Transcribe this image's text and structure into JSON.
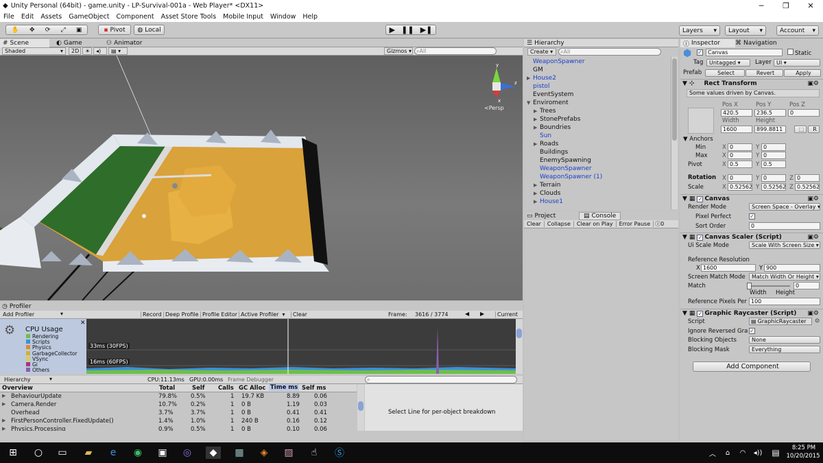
{
  "window": {
    "title": "Unity Personal (64bit) - game.unity - LP-Survival-001a - Web Player* <DX11>"
  },
  "menu": [
    "File",
    "Edit",
    "Assets",
    "GameObject",
    "Component",
    "Asset Store Tools",
    "Mobile Input",
    "Window",
    "Help"
  ],
  "toolbar": {
    "pivot": "Pivot",
    "local": "Local",
    "layers": "Layers",
    "layout": "Layout",
    "account": "Account"
  },
  "scene": {
    "tabs": {
      "scene": "Scene",
      "game": "Game",
      "animator": "Animator"
    },
    "shading": "Shaded",
    "mode2d": "2D",
    "gizmos": "Gizmos",
    "search_placeholder": "All",
    "persp": "Persp",
    "axis_y": "y",
    "axis_x": "x",
    "axis_z": "z"
  },
  "hierarchy": {
    "tab": "Hierarchy",
    "create": "Create",
    "search_placeholder": "All",
    "items": [
      {
        "label": "WeaponSpawner",
        "blue": true,
        "indent": 0,
        "arrow": ""
      },
      {
        "label": "GM",
        "blue": false,
        "indent": 0,
        "arrow": ""
      },
      {
        "label": "House2",
        "blue": true,
        "indent": 0,
        "arrow": "▶"
      },
      {
        "label": "pistol",
        "blue": true,
        "indent": 0,
        "arrow": ""
      },
      {
        "label": "EventSystem",
        "blue": false,
        "indent": 0,
        "arrow": ""
      },
      {
        "label": "Enviroment",
        "blue": false,
        "indent": 0,
        "arrow": "▼"
      },
      {
        "label": "Trees",
        "blue": false,
        "indent": 1,
        "arrow": "▶"
      },
      {
        "label": "StonePrefabs",
        "blue": false,
        "indent": 1,
        "arrow": "▶"
      },
      {
        "label": "Boundries",
        "blue": false,
        "indent": 1,
        "arrow": "▶"
      },
      {
        "label": "Sun",
        "blue": true,
        "indent": 1,
        "arrow": ""
      },
      {
        "label": "Roads",
        "blue": false,
        "indent": 1,
        "arrow": "▶"
      },
      {
        "label": "Buildings",
        "blue": false,
        "indent": 1,
        "arrow": ""
      },
      {
        "label": "EnemySpawning",
        "blue": false,
        "indent": 1,
        "arrow": ""
      },
      {
        "label": "WeaponSpawner",
        "blue": true,
        "indent": 1,
        "arrow": ""
      },
      {
        "label": "WeaponSpawner (1)",
        "blue": true,
        "indent": 1,
        "arrow": ""
      },
      {
        "label": "Terrain",
        "blue": false,
        "indent": 1,
        "arrow": "▶"
      },
      {
        "label": "Clouds",
        "blue": false,
        "indent": 1,
        "arrow": "▶"
      },
      {
        "label": "House1",
        "blue": true,
        "indent": 1,
        "arrow": "▶"
      }
    ]
  },
  "project": {
    "tab_project": "Project",
    "tab_console": "Console",
    "clear": "Clear",
    "collapse": "Collapse",
    "clear_on_play": "Clear on Play",
    "error_pause": "Error Pause",
    "count": "0"
  },
  "inspector": {
    "tab": "Inspector",
    "tab_nav": "Navigation",
    "object_name": "Canvas",
    "static": "Static",
    "tag_label": "Tag",
    "tag": "Untagged",
    "layer_label": "Layer",
    "layer": "UI",
    "prefab": "Prefab",
    "select": "Select",
    "revert": "Revert",
    "apply": "Apply",
    "rect_transform": "Rect Transform",
    "driven": "Some values driven by Canvas.",
    "posx_label": "Pos X",
    "posy_label": "Pos Y",
    "posz_label": "Pos Z",
    "posx": "420.5",
    "posy": "236.5",
    "posz": "0",
    "width_label": "Width",
    "height_label": "Height",
    "width": "1600",
    "height": "899.8811",
    "r_btn": "R",
    "anchors": "Anchors",
    "min": "Min",
    "max": "Max",
    "pivot": "Pivot",
    "anchor_min_x": "0",
    "anchor_min_y": "0",
    "anchor_max_x": "0",
    "anchor_max_y": "0",
    "pivot_x": "0.5",
    "pivot_y": "0.5",
    "rotation": "Rotation",
    "rot_x": "0",
    "rot_y": "0",
    "rot_z": "0",
    "scale": "Scale",
    "scale_x": "0.52562",
    "scale_y": "0.52562",
    "scale_z": "0.52562",
    "x_lbl": "X",
    "y_lbl": "Y",
    "z_lbl": "Z",
    "canvas": "Canvas",
    "render_mode_label": "Render Mode",
    "render_mode": "Screen Space - Overlay",
    "pixel_perfect": "Pixel Perfect",
    "sort_order_label": "Sort Order",
    "sort_order": "0",
    "canvas_scaler": "Canvas Scaler (Script)",
    "ui_scale_label": "Ui Scale Mode",
    "ui_scale": "Scale With Screen Size",
    "ref_res": "Reference Resolution",
    "ref_x": "1600",
    "ref_y": "900",
    "screen_match_label": "Screen Match Mode",
    "screen_match": "Match Width Or Height",
    "match_label": "Match",
    "match_value": "0",
    "match_width": "Width",
    "match_height": "Height",
    "ref_ppu_label": "Reference Pixels Per",
    "ref_ppu": "100",
    "raycaster": "Graphic Raycaster (Script)",
    "script_label": "Script",
    "script": "GraphicRaycaster",
    "ignore_reversed": "Ignore Reversed Gra",
    "blocking_objects_label": "Blocking Objects",
    "blocking_objects": "None",
    "blocking_mask_label": "Blocking Mask",
    "blocking_mask": "Everything",
    "add_component": "Add Component"
  },
  "profiler": {
    "tab": "Profiler",
    "add_profiler": "Add Profiler",
    "record": "Record",
    "deep_profile": "Deep Profile",
    "profile_editor": "Profile Editor",
    "active_profiler": "Active Profiler",
    "clear": "Clear",
    "frame_label": "Frame:",
    "frame": "3616 / 3774",
    "current": "Current",
    "cpu_usage": "CPU Usage",
    "legend": [
      {
        "label": "Rendering",
        "color": "#6fbf4a"
      },
      {
        "label": "Scripts",
        "color": "#3d8fd8"
      },
      {
        "label": "Physics",
        "color": "#e08a2c"
      },
      {
        "label": "GarbageCollector",
        "color": "#c9b434"
      },
      {
        "label": "VSync",
        "color": "#d8d04a"
      },
      {
        "label": "Gi",
        "color": "#a8327a"
      },
      {
        "label": "Others",
        "color": "#8a5fb0"
      }
    ],
    "line30": "33ms (30FPS)",
    "line60": "16ms (60FPS)",
    "hierarchy_mode": "Hierarchy",
    "cpu_time": "CPU:11.13ms",
    "gpu_time": "GPU:0.00ms",
    "frame_debugger": "Frame Debugger",
    "columns": {
      "overview": "Overview",
      "total": "Total",
      "self": "Self",
      "calls": "Calls",
      "gc": "GC Alloc",
      "time": "Time ms",
      "selfms": "Self ms"
    },
    "rows": [
      {
        "name": "BehaviourUpdate",
        "arrow": "▶",
        "total": "79.8%",
        "self": "0.5%",
        "calls": "1",
        "gc": "19.7 KB",
        "time": "8.89",
        "selfms": "0.06"
      },
      {
        "name": "Camera.Render",
        "arrow": "▶",
        "total": "10.7%",
        "self": "0.2%",
        "calls": "1",
        "gc": "0 B",
        "time": "1.19",
        "selfms": "0.03"
      },
      {
        "name": "Overhead",
        "arrow": "",
        "total": "3.7%",
        "self": "3.7%",
        "calls": "1",
        "gc": "0 B",
        "time": "0.41",
        "selfms": "0.41"
      },
      {
        "name": "FirstPersonController.FixedUpdate()",
        "arrow": "▶",
        "total": "1.4%",
        "self": "1.0%",
        "calls": "1",
        "gc": "240 B",
        "time": "0.16",
        "selfms": "0.12"
      },
      {
        "name": "Physics.Processing",
        "arrow": "▶",
        "total": "0.9%",
        "self": "0.5%",
        "calls": "1",
        "gc": "0 B",
        "time": "0.10",
        "selfms": "0.06"
      }
    ],
    "select_line": "Select Line for per-object breakdown"
  },
  "taskbar": {
    "time": "8:25 PM",
    "date": "10/20/2015"
  }
}
